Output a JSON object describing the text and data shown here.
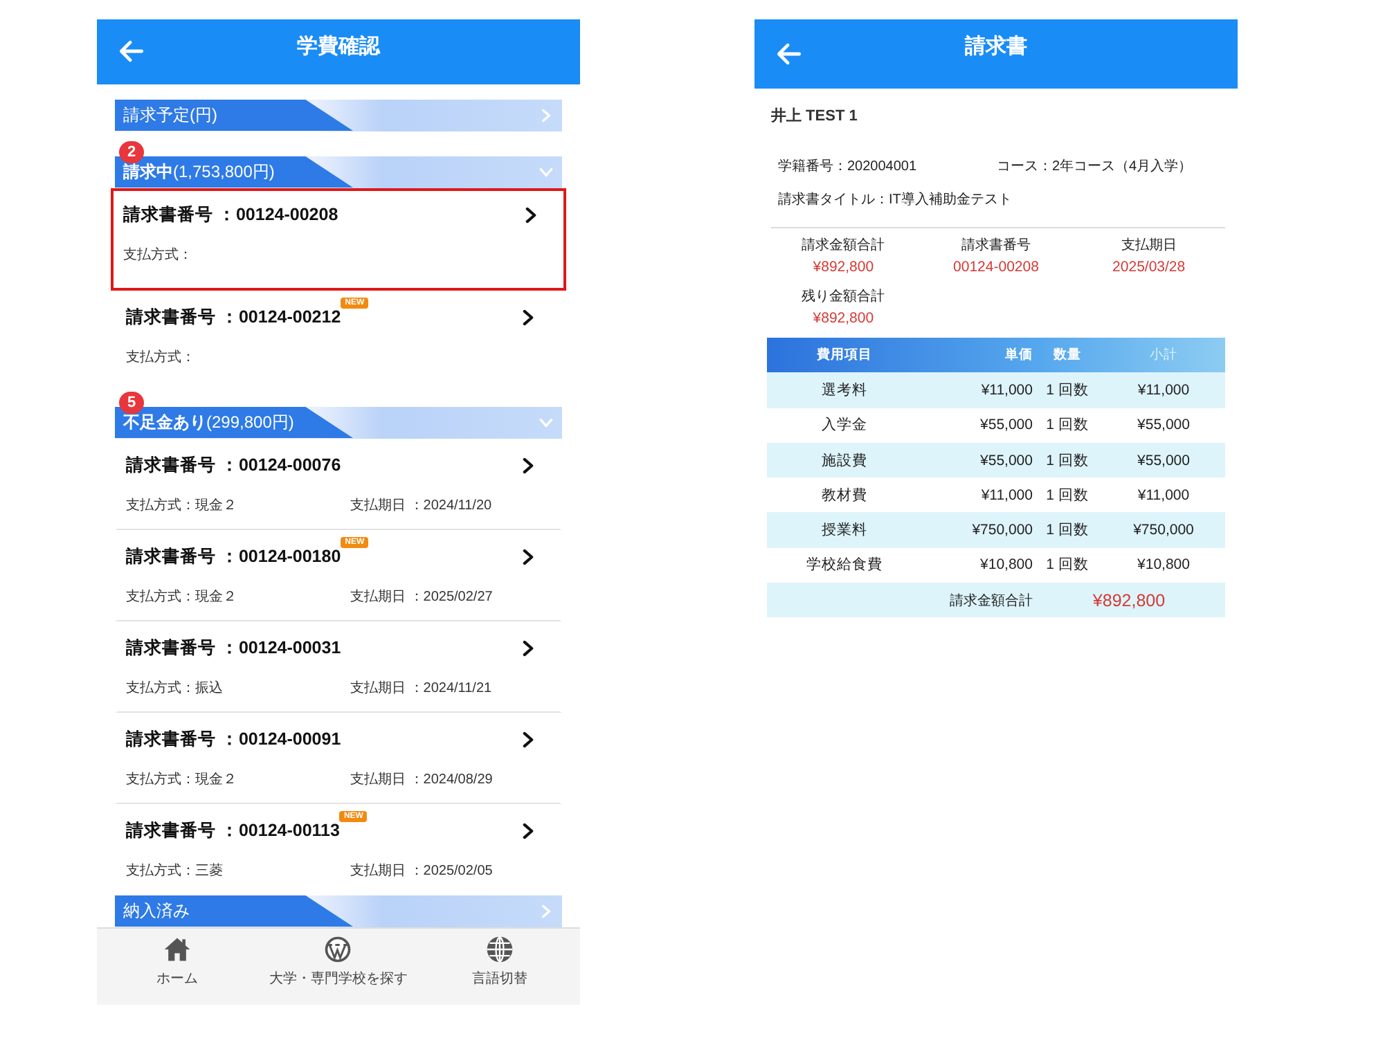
{
  "fee_screen": {
    "header": {
      "title": "学費確認"
    },
    "sections": [
      {
        "title": "請求予定(円)",
        "expanded": false
      },
      {
        "title": "**請求中**(1,753,800円)",
        "badge": "2",
        "expanded": true,
        "invoices": [
          {
            "number": "請求書番号 ：00124-00208",
            "highlighted": true,
            "payment": "支払方式："
          },
          {
            "number": "請求書番号 ：00124-00212",
            "new_tag": "NEW",
            "highlighted": false,
            "payment": "支払方式："
          }
        ]
      },
      {
        "title": "**不足金あり**(299,800円)",
        "badge": "5",
        "expanded": true,
        "invoices": [
          {
            "number": "請求書番号 ：00124-00076",
            "highlighted": false,
            "payment": "支払方式：現金２",
            "due": "支払期日 ：2024/11/20"
          },
          {
            "number": "請求書番号 ：00124-00180",
            "new_tag": "NEW",
            "highlighted": false,
            "payment": "支払方式：現金２",
            "due": "支払期日 ：2025/02/27"
          },
          {
            "number": "請求書番号 ：00124-00031",
            "highlighted": false,
            "payment": "支払方式：振込",
            "due": "支払期日 ：2024/11/21"
          },
          {
            "number": "請求書番号 ：00124-00091",
            "highlighted": false,
            "payment": "支払方式：現金２",
            "due": "支払期日 ：2024/08/29"
          },
          {
            "number": "請求書番号 ：00124-00113",
            "new_tag": "NEW",
            "highlighted": false,
            "payment": "支払方式：三菱",
            "due": "支払期日 ：2025/02/05"
          }
        ]
      },
      {
        "title": "納入済み",
        "expanded": false
      }
    ],
    "bottom_nav": [
      {
        "kind": "home",
        "label": "ホーム"
      },
      {
        "kind": "wordpress",
        "label": "大学・専門学校を探す"
      },
      {
        "kind": "globe",
        "label": "言語切替"
      }
    ]
  },
  "invoice_screen": {
    "header": {
      "title": "請求書"
    },
    "student_name": "井上 TEST 1",
    "student_number": "学籍番号：202004001",
    "course": "コース：2年コース（4月入学）",
    "invoice_title": "請求書タイトル：IT導入補助金テスト",
    "summary": [
      {
        "label": "請求金額合計",
        "value": "¥892,800"
      },
      {
        "label": "請求書番号",
        "value": "00124-00208"
      },
      {
        "label": "支払期日",
        "value": "2025/03/28"
      },
      {
        "label": "残り金額合計",
        "value": "¥892,800"
      }
    ],
    "table": {
      "columns": [
        "費用項目",
        "単価",
        "数量",
        "小計"
      ],
      "rows": [
        [
          "選考料",
          "¥11,000",
          "1 回数",
          "¥11,000"
        ],
        [
          "入学金",
          "¥55,000",
          "1 回数",
          "¥55,000"
        ],
        [
          "施設費",
          "¥55,000",
          "1 回数",
          "¥55,000"
        ],
        [
          "教材費",
          "¥11,000",
          "1 回数",
          "¥11,000"
        ],
        [
          "授業料",
          "¥750,000",
          "1 回数",
          "¥750,000"
        ],
        [
          "学校給食費",
          "¥10,800",
          "1 回数",
          "¥10,800"
        ]
      ],
      "total": {
        "label": "請求金額合計",
        "value": "¥892,800"
      }
    }
  }
}
